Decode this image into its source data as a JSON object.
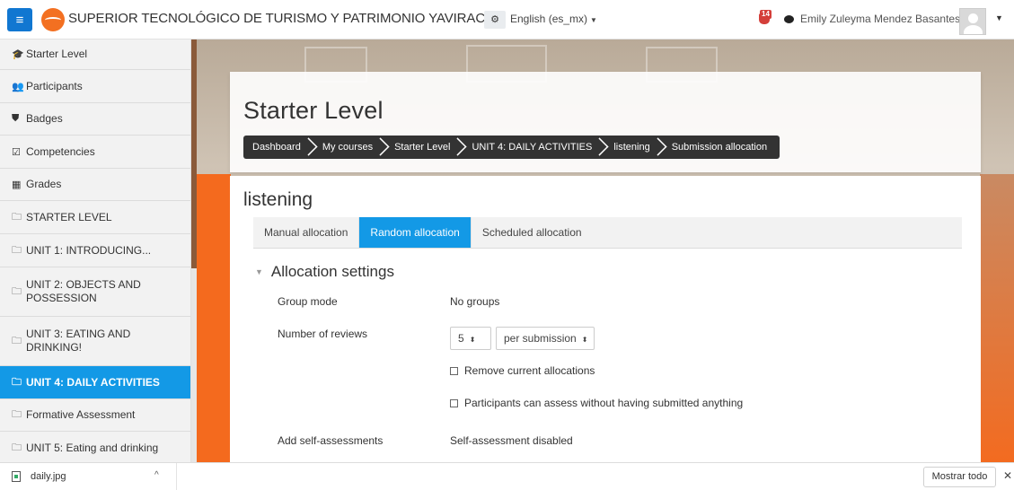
{
  "navbar": {
    "menu_icon": "hamburger-icon",
    "site_name": "SUPERIOR TECNOLÓGICO DE TURISMO Y PATRIMONIO YAVIRAC",
    "gear_icon": "⚙",
    "language": "English (es_mx)",
    "notification_count": "14",
    "user_name": "Emily Zuleyma Mendez Basantes"
  },
  "sidebar": {
    "items": [
      {
        "icon": "🎓",
        "icon_name": "graduation-cap-icon",
        "label": "Starter Level"
      },
      {
        "icon": "👥",
        "icon_name": "users-icon",
        "label": "Participants"
      },
      {
        "icon": "⛊",
        "icon_name": "shield-icon",
        "label": "Badges"
      },
      {
        "icon": "☑",
        "icon_name": "check-square-icon",
        "label": "Competencies"
      },
      {
        "icon": "▦",
        "icon_name": "table-icon",
        "label": "Grades"
      },
      {
        "icon": "🗀",
        "icon_name": "folder-icon",
        "label": "STARTER LEVEL"
      },
      {
        "icon": "🗀",
        "icon_name": "folder-icon",
        "label": "UNIT 1: INTRODUCING..."
      },
      {
        "icon": "🗀",
        "icon_name": "folder-icon",
        "label": "UNIT 2: OBJECTS AND POSSESSION"
      },
      {
        "icon": "🗀",
        "icon_name": "folder-icon",
        "label": "UNIT 3: EATING AND DRINKING!"
      },
      {
        "icon": "🗀",
        "icon_name": "folder-icon",
        "label": "UNIT 4: DAILY ACTIVITIES"
      },
      {
        "icon": "🗀",
        "icon_name": "folder-icon",
        "label": "Formative Assessment"
      },
      {
        "icon": "🗀",
        "icon_name": "folder-icon",
        "label": "UNIT 5: Eating and drinking"
      }
    ]
  },
  "course": {
    "title": "Starter Level",
    "breadcrumb": [
      "Dashboard",
      "My courses",
      "Starter Level",
      "UNIT 4: DAILY ACTIVITIES",
      "listening",
      "Submission allocation"
    ]
  },
  "activity": {
    "title": "listening",
    "tabs": [
      "Manual allocation",
      "Random allocation",
      "Scheduled allocation"
    ],
    "section_title": "Allocation settings",
    "group_mode_label": "Group mode",
    "group_mode_value": "No groups",
    "reviews_label": "Number of reviews",
    "reviews_value": "5",
    "reviews_per": "per submission",
    "remove_allocations": "Remove current allocations",
    "assess_without_submitting": "Participants can assess without having submitted anything",
    "self_assessment_label": "Add self-assessments",
    "self_assessment_value": "Self-assessment disabled"
  },
  "download_bar": {
    "file_name": "daily.jpg",
    "show_all": "Mostrar todo"
  }
}
